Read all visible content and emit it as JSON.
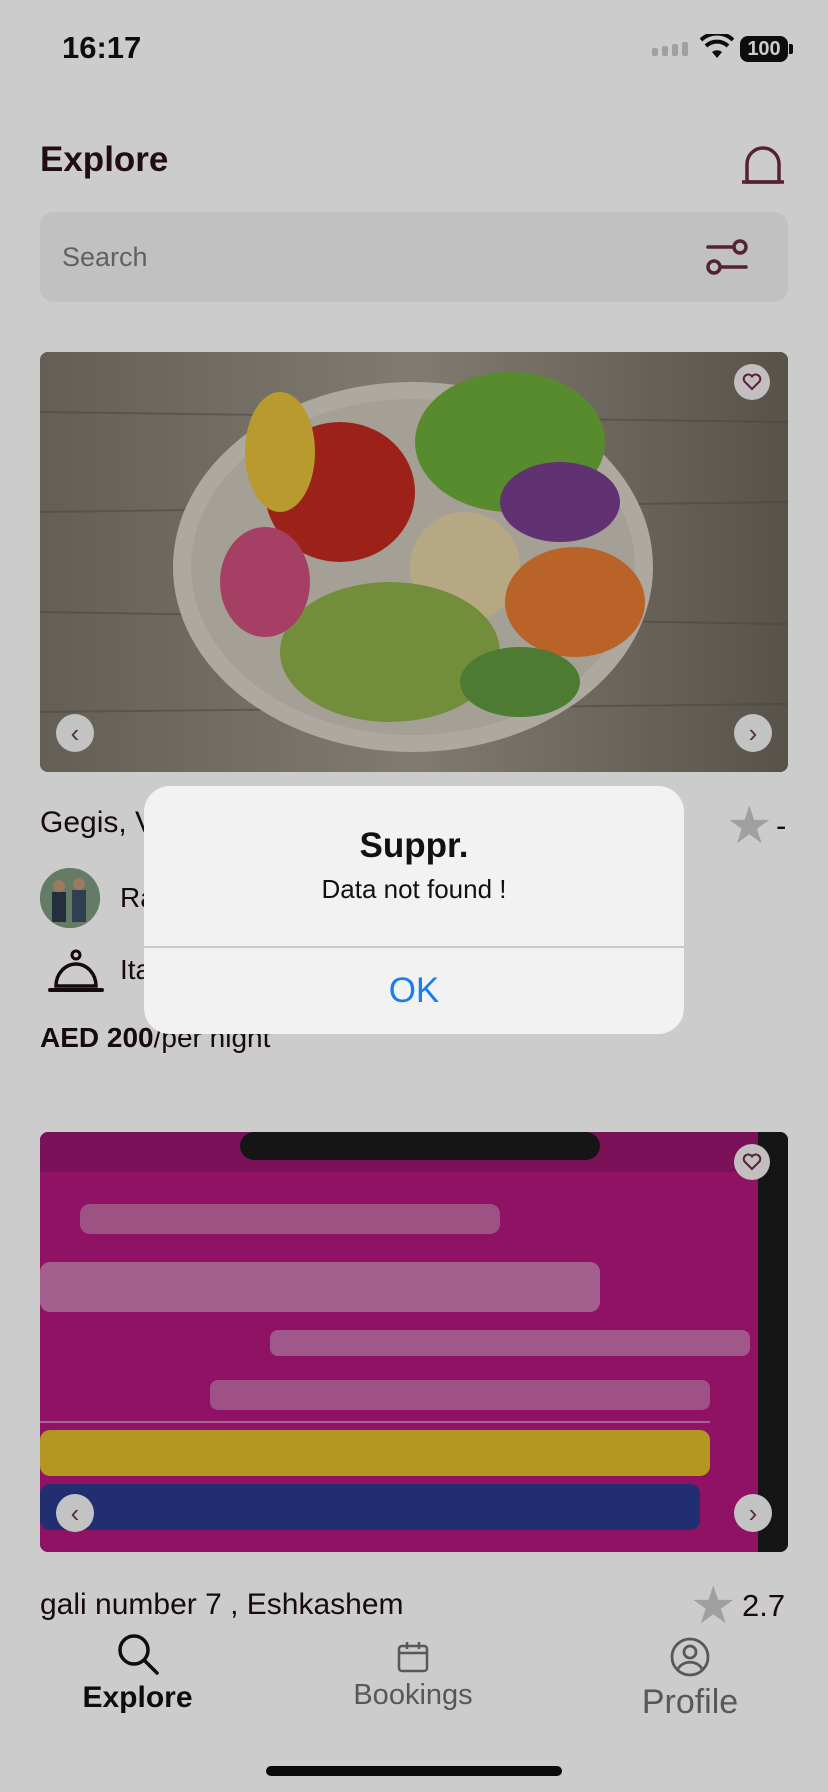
{
  "status_bar": {
    "time": "16:17",
    "battery": "100"
  },
  "header": {
    "title": "Explore",
    "bell_icon": "bell-icon"
  },
  "search": {
    "placeholder": "Search",
    "filter_icon": "sliders-icon"
  },
  "listings": [
    {
      "title": "Gegis, V",
      "rating": "-",
      "host_name": "Ra",
      "cuisine": "Ita",
      "price_amount": "AED 200",
      "price_unit": "/per night"
    },
    {
      "title": "gali number 7 , Eshkashem",
      "rating": "2.7"
    }
  ],
  "tabs": [
    {
      "label": "Explore",
      "icon": "search-icon",
      "active": true
    },
    {
      "label": "Bookings",
      "icon": "calendar-icon",
      "active": false
    },
    {
      "label": "Profile",
      "icon": "profile-icon",
      "active": false
    }
  ],
  "alert": {
    "title": "Suppr.",
    "message": "Data not found !",
    "ok_label": "OK"
  },
  "colors": {
    "accent": "#6a2b45",
    "link": "#1a7cf0",
    "search_bg": "#f2f2f2"
  }
}
